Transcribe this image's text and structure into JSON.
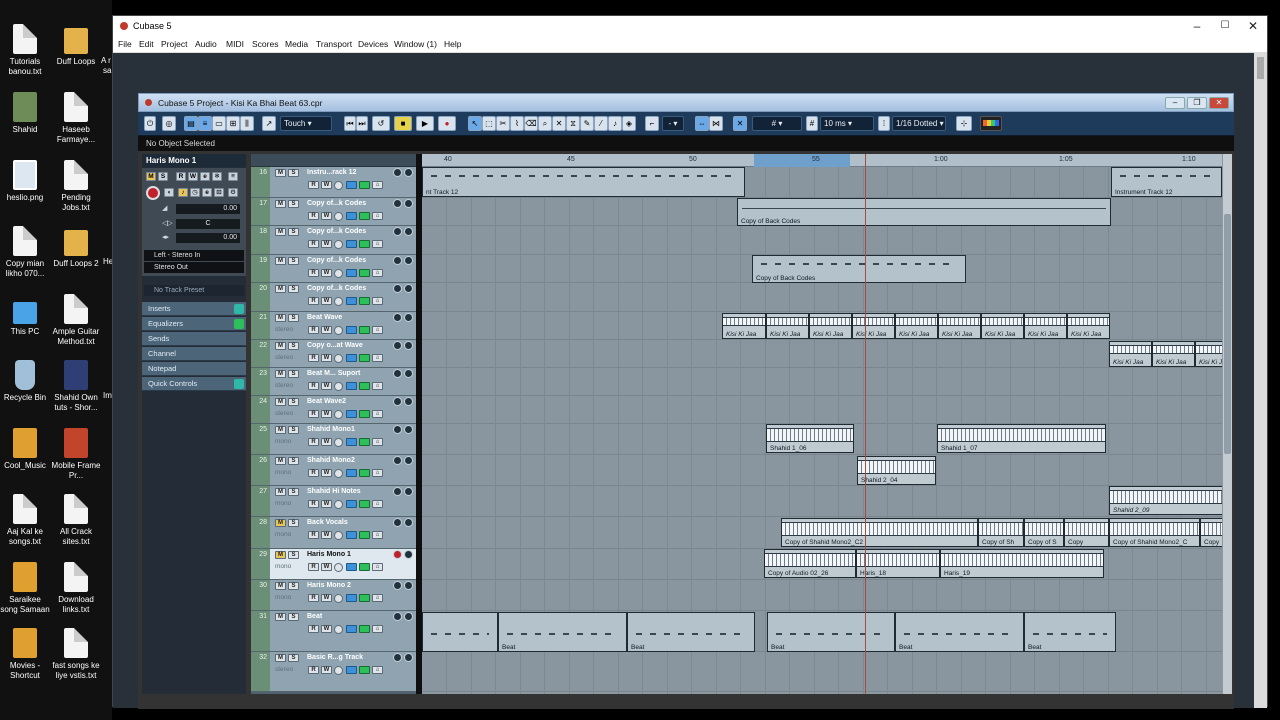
{
  "desktop": {
    "icons": [
      {
        "label": "Tutorials banou.txt",
        "icon": "txt-file-icon"
      },
      {
        "label": "Duff Loops",
        "icon": "folder-icon"
      },
      {
        "label": "Shahid",
        "icon": "user-folder-icon"
      },
      {
        "label": "Haseeb Farmaye...",
        "icon": "txt-file-icon"
      },
      {
        "label": "heslio.png",
        "icon": "image-file-icon"
      },
      {
        "label": "Pending Jobs.txt",
        "icon": "txt-file-icon"
      },
      {
        "label": "Copy mian likho 070...",
        "icon": "txt-file-icon"
      },
      {
        "label": "Duff Loops 2",
        "icon": "folder-icon"
      },
      {
        "label": "This PC",
        "icon": "computer-icon"
      },
      {
        "label": "Ample Guitar Method.txt",
        "icon": "txt-file-icon"
      },
      {
        "label": "Recycle Bin",
        "icon": "recycle-bin-icon"
      },
      {
        "label": "Shahid Own tuts - Shor...",
        "icon": "media-file-icon"
      },
      {
        "label": "Cool_Music",
        "icon": "mp3-file-icon"
      },
      {
        "label": "Mobile Frame Pr...",
        "icon": "video-file-icon"
      },
      {
        "label": "Aaj Kal ke songs.txt",
        "icon": "txt-file-icon"
      },
      {
        "label": "All Crack sites.txt",
        "icon": "txt-file-icon"
      },
      {
        "label": "Saraikee song Samaan",
        "icon": "mp3-file-icon"
      },
      {
        "label": "Download links.txt",
        "icon": "txt-file-icon"
      },
      {
        "label": "Movies - Shortcut",
        "icon": "shortcut-icon"
      },
      {
        "label": "fast songs ke liye vstis.txt",
        "icon": "txt-file-icon"
      }
    ],
    "partial": [
      "A r",
      "sa",
      "He",
      "Im"
    ]
  },
  "app": {
    "title": "Cubase 5",
    "menus": [
      "File",
      "Edit",
      "Project",
      "Audio",
      "MIDI",
      "Scores",
      "Media",
      "Transport",
      "Devices",
      "Window (1)",
      "Help"
    ]
  },
  "project": {
    "title": "Cubase 5 Project - Kisi Ka Bhai Beat 63.cpr",
    "automation_mode": "Touch",
    "grid_type": "10 ms",
    "quantize": "1/16 Dotted",
    "info_line": "No Object Selected"
  },
  "inspector": {
    "track_name": "Haris Mono 1",
    "volume": "0.00",
    "pan": "C",
    "delay": "0.00",
    "input": "Left - Stereo In",
    "output": "Stereo Out",
    "preset": "No Track Preset",
    "sections": [
      "Inserts",
      "Equalizers",
      "Sends",
      "Channel",
      "Notepad",
      "Quick Controls"
    ]
  },
  "tracks": [
    {
      "num": "16",
      "name": "Instru...rack 12",
      "sub": ""
    },
    {
      "num": "17",
      "name": "Copy of...k Codes",
      "sub": ""
    },
    {
      "num": "18",
      "name": "Copy of...k Codes",
      "sub": ""
    },
    {
      "num": "19",
      "name": "Copy of...k Codes",
      "sub": ""
    },
    {
      "num": "20",
      "name": "Copy of...k Codes",
      "sub": ""
    },
    {
      "num": "21",
      "name": "Beat Wave",
      "sub": "stereo"
    },
    {
      "num": "22",
      "name": "Copy o...at Wave",
      "sub": "stereo"
    },
    {
      "num": "23",
      "name": "Beat M... Suport",
      "sub": "stereo"
    },
    {
      "num": "24",
      "name": "Beat Wave2",
      "sub": "stereo"
    },
    {
      "num": "25",
      "name": "Shahid Mono1",
      "sub": "mono"
    },
    {
      "num": "26",
      "name": "Shahid Mono2",
      "sub": "mono"
    },
    {
      "num": "27",
      "name": "Shahid Hi Notes",
      "sub": "mono"
    },
    {
      "num": "28",
      "name": "Back Vocals",
      "sub": "mono"
    },
    {
      "num": "29",
      "name": "Haris Mono 1",
      "sub": "mono"
    },
    {
      "num": "30",
      "name": "Haris Mono 2",
      "sub": "mono"
    },
    {
      "num": "31",
      "name": "Beat",
      "sub": ""
    },
    {
      "num": "32",
      "name": "Basic R...g Track",
      "sub": "stereo"
    }
  ],
  "ruler": [
    "40",
    "45",
    "50",
    "55",
    "1:00",
    "1:05",
    "1:10"
  ],
  "events": {
    "instrument_left": "nt Track 12",
    "instrument_right": "Instrument Track 12",
    "back_codes_1": "Copy of Back Codes",
    "back_codes_2": "Copy of Back Codes",
    "kisi_ki_jaa": "Kisi Ki Jaa",
    "shahid_1_06": "Shahid 1_06",
    "shahid_1_07": "Shahid 1_07",
    "shahid_2_04": "Shahid 2_04",
    "shahid_2_09": "Shahid 2_09",
    "copy_shahid_c2": "Copy of Shahid Mono2_C2",
    "copy_of_sh": "Copy of Sh",
    "copy_of_s": "Copy of S",
    "copy_short": "Copy",
    "copy_shahid_c": "Copy of Shahid Mono2_C",
    "copy_audio": "Copy of Audio 02_26",
    "haris_18": "Haris_18",
    "haris_19": "Haris_19",
    "beat": "Beat"
  }
}
